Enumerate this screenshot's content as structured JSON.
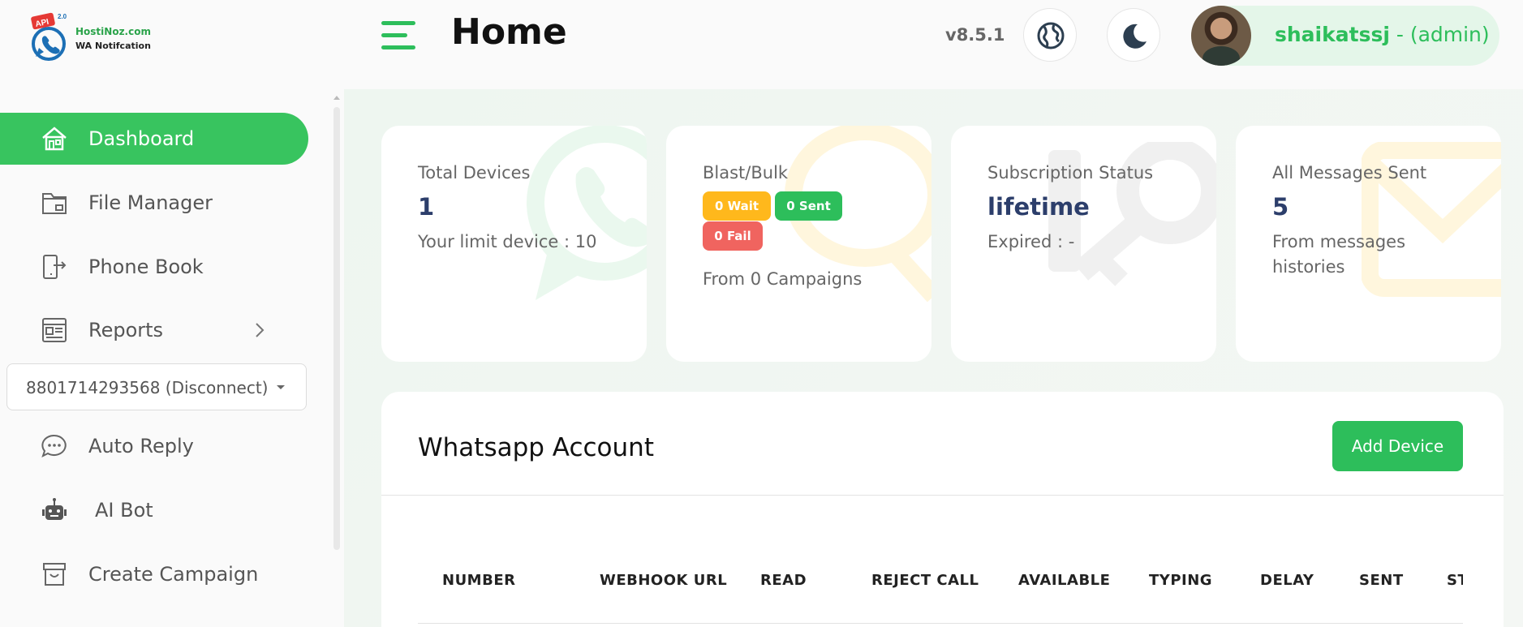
{
  "header": {
    "logo": {
      "line1": "HostiNoz.com",
      "line2": "WA Notifcation",
      "badge": "API",
      "badge_sup": "2.0"
    },
    "page_title": "Home",
    "version": "v8.5.1",
    "language_icon": "globe-icon",
    "theme_icon": "moon-icon",
    "user": {
      "name": "shaikatssj",
      "role": " - (admin)"
    },
    "accent": "#2dbe5b"
  },
  "sidebar": {
    "items": [
      {
        "label": "Dashboard",
        "icon": "home-icon",
        "active": true
      },
      {
        "label": "File Manager",
        "icon": "folder-icon"
      },
      {
        "label": "Phone Book",
        "icon": "phone-book-icon"
      },
      {
        "label": "Reports",
        "icon": "report-icon"
      },
      {
        "label": "Auto Reply",
        "icon": "chat-bubble-icon"
      },
      {
        "label": "AI Bot",
        "icon": "robot-icon"
      },
      {
        "label": "Create Campaign",
        "icon": "campaign-box-icon"
      }
    ],
    "device_select": {
      "value": "8801714293568 (Disconnect)"
    }
  },
  "cards": [
    {
      "label": "Total Devices",
      "value": "1",
      "sub": "Your limit device : 10",
      "icon": "whatsapp-icon"
    },
    {
      "label": "Blast/Bulk",
      "badges": {
        "wait": "0 Wait",
        "sent": "0 Sent",
        "fail": "0 Fail"
      },
      "sub": "From 0 Campaigns",
      "icon": "chat-bubble-icon"
    },
    {
      "label": "Subscription Status",
      "value": "lifetime",
      "sub": "Expired : -",
      "icon": "key-icon"
    },
    {
      "label": "All Messages Sent",
      "value": "5",
      "sub": "From messages histories",
      "icon": "envelope-icon"
    }
  ],
  "whatsapp_account": {
    "title": "Whatsapp Account",
    "add_button": "Add Device",
    "columns": [
      "NUMBER",
      "WEBHOOK URL",
      "READ",
      "REJECT CALL",
      "AVAILABLE",
      "TYPING",
      "DELAY",
      "SENT",
      "ST"
    ]
  }
}
